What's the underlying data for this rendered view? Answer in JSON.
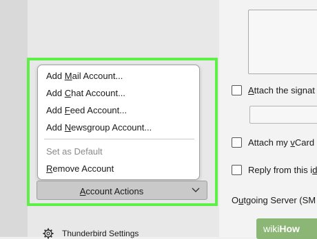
{
  "menu": {
    "items": [
      {
        "pre": "Add ",
        "key": "M",
        "post": "ail Account..."
      },
      {
        "pre": "Add ",
        "key": "C",
        "post": "hat Account..."
      },
      {
        "pre": "Add ",
        "key": "F",
        "post": "eed Account..."
      },
      {
        "pre": "Add ",
        "key": "N",
        "post": "ewsgroup Account..."
      }
    ],
    "set_default": "Set as Default",
    "remove": {
      "key": "R",
      "post": "emove Account"
    }
  },
  "account_actions": {
    "pre": "",
    "key": "A",
    "post": "ccount Actions"
  },
  "settings_link": "Thunderbird Settings",
  "right_panel": {
    "attach_signature": {
      "pre": "",
      "key": "A",
      "post": "ttach the signat"
    },
    "attach_vcard": {
      "pre": "Attach my ",
      "key": "v",
      "post": "Card"
    },
    "reply_from": {
      "pre": "Reply from this i",
      "key": "d",
      "post": ""
    },
    "outgoing_server": {
      "pre": "O",
      "key": "u",
      "post": "tgoing Server (SM"
    }
  },
  "watermark": {
    "brand_a": "wiki",
    "brand_b": "How"
  },
  "colors": {
    "highlight": "#5ff048",
    "button": "#c9c9c9"
  },
  "icons": {
    "settings": "gear-icon",
    "dropdown": "chevron-down-icon"
  }
}
